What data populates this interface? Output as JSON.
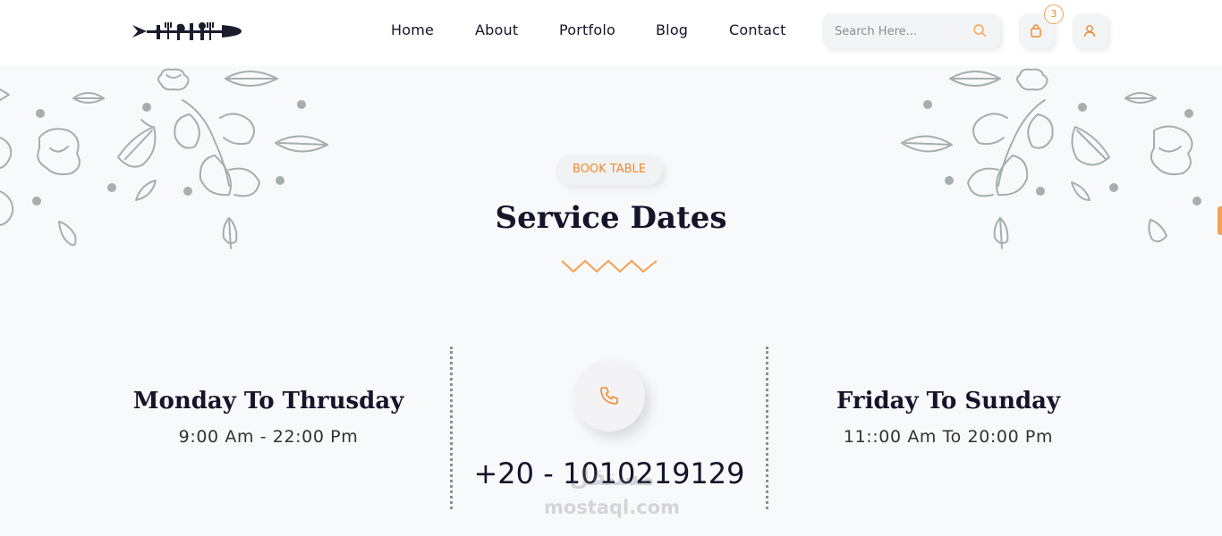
{
  "nav": {
    "items": [
      "Home",
      "About",
      "Portfolo",
      "Blog",
      "Contact"
    ]
  },
  "search": {
    "placeholder": "Search Here..."
  },
  "cart": {
    "count": "3",
    "icon": "shopping-bag-icon"
  },
  "account": {
    "icon": "user-icon"
  },
  "hero": {
    "badge": "BOOK TABLE",
    "title": "Service Dates"
  },
  "schedule": {
    "left": {
      "title": "Monday To Thrusday",
      "hours": "9:00 Am - 22:00 Pm"
    },
    "right": {
      "title": "Friday To Sunday",
      "hours": "11::00 Am To 20:00 Pm"
    },
    "phone": {
      "number": "+20 - 1010219129",
      "icon": "phone-icon"
    }
  },
  "watermark": {
    "arabic": "مستقل",
    "latin": "mostaql.com"
  },
  "colors": {
    "accent": "#ef8a2c",
    "text": "#14142a",
    "background": "#f8f9fb",
    "decoration": "#a6aeae"
  }
}
